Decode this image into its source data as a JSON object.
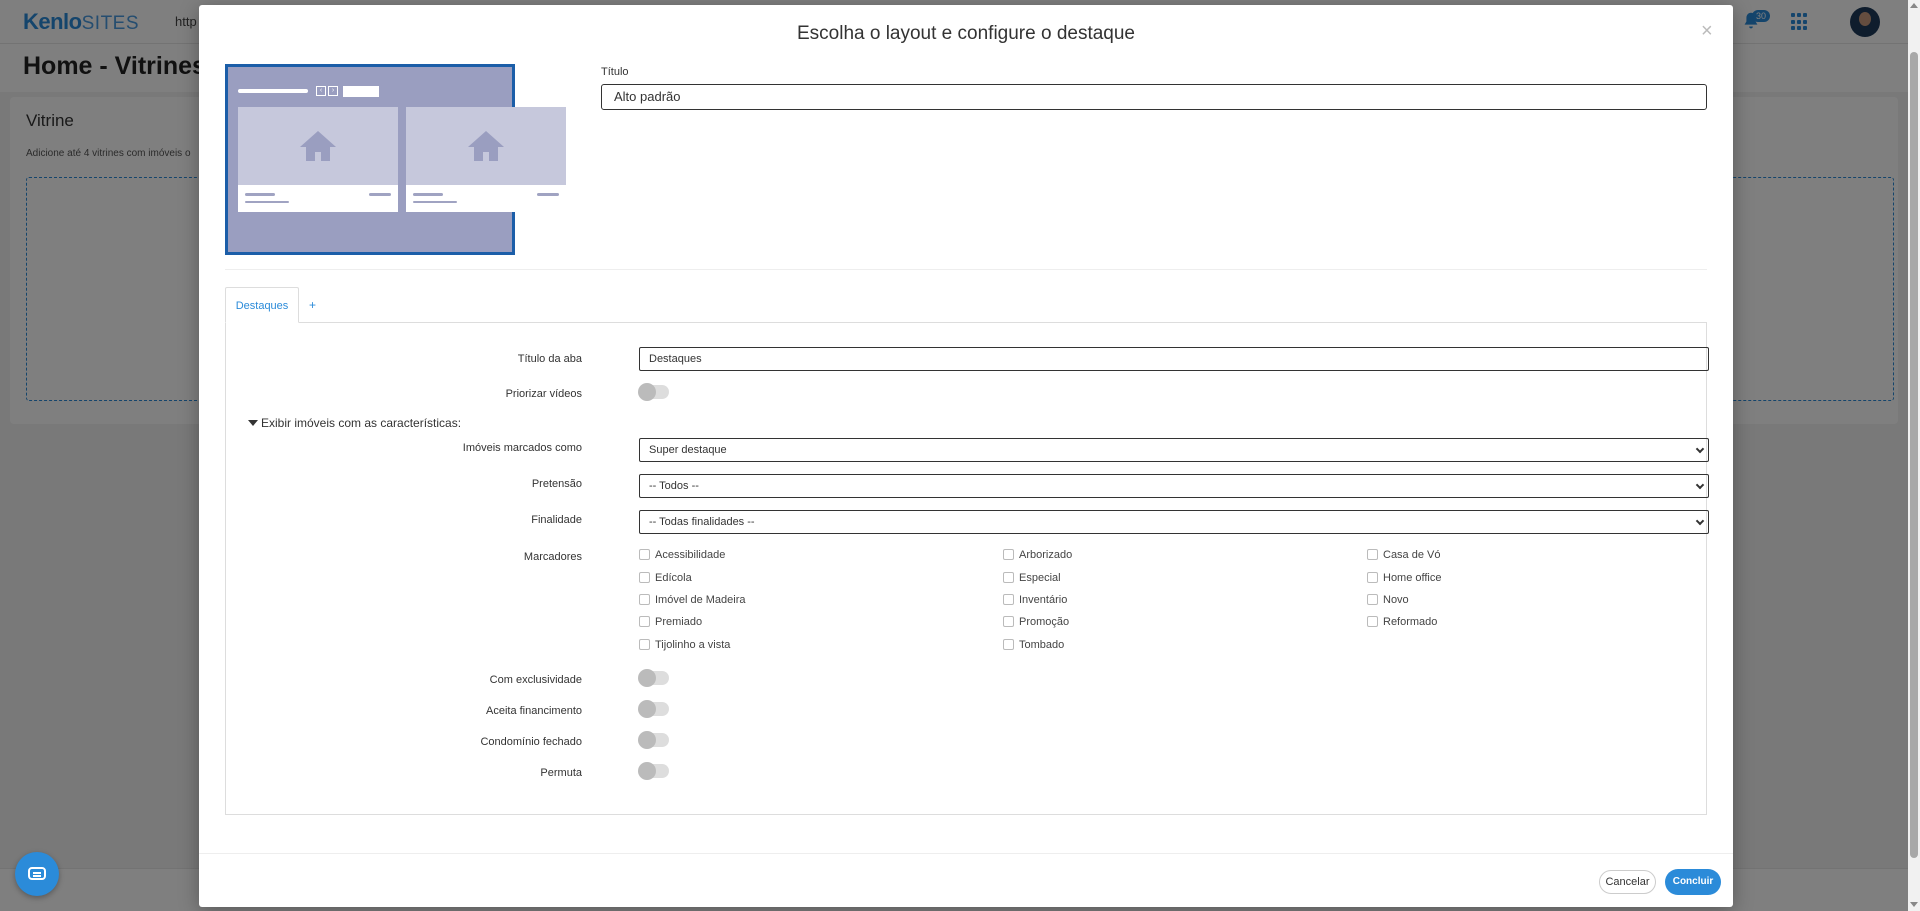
{
  "app": {
    "logo_main": "Kenlo",
    "logo_sub": "SITES",
    "url_stub": "http",
    "notification_count": "30",
    "page_title": "Home - Vitrines"
  },
  "background": {
    "section_title": "Vitrine",
    "section_desc": "Adicione até 4 vitrines com imóveis o"
  },
  "modal": {
    "title": "Escolha o layout e configure o destaque",
    "close_symbol": "×",
    "title_label": "Título",
    "title_value": "Alto padrão",
    "tabs": [
      {
        "label": "Destaques"
      }
    ],
    "add_tab_label": "+",
    "form": {
      "tab_title_label": "Título da aba",
      "tab_title_value": "Destaques",
      "prioritize_videos_label": "Priorizar vídeos",
      "prioritize_videos_on": false,
      "filter_heading": "Exibir imóveis com as características:",
      "marked_as_label": "Imóveis marcados como",
      "marked_as_value": "Super destaque",
      "pretension_label": "Pretensão",
      "pretension_value": "-- Todos --",
      "purpose_label": "Finalidade",
      "purpose_value": "-- Todas finalidades --",
      "markers_label": "Marcadores",
      "markers": [
        {
          "label": "Acessibilidade",
          "checked": false
        },
        {
          "label": "Arborizado",
          "checked": false
        },
        {
          "label": "Casa de Vó",
          "checked": false
        },
        {
          "label": "Edícola",
          "checked": false
        },
        {
          "label": "Especial",
          "checked": false
        },
        {
          "label": "Home office",
          "checked": false
        },
        {
          "label": "Imóvel de Madeira",
          "checked": false
        },
        {
          "label": "Inventário",
          "checked": false
        },
        {
          "label": "Novo",
          "checked": false
        },
        {
          "label": "Premiado",
          "checked": false
        },
        {
          "label": "Promoção",
          "checked": false
        },
        {
          "label": "Reformado",
          "checked": false
        },
        {
          "label": "Tijolinho a vista",
          "checked": false
        },
        {
          "label": "Tombado",
          "checked": false
        }
      ],
      "exclusive_label": "Com exclusividade",
      "exclusive_on": false,
      "financing_label": "Aceita financimento",
      "financing_on": false,
      "gated_label": "Condomínio fechado",
      "gated_on": false,
      "swap_label": "Permuta",
      "swap_on": false
    },
    "cancel_label": "Cancelar",
    "confirm_label": "Concluir"
  },
  "colors": {
    "accent": "#2b8bd9",
    "preview_bg": "#9a9ec0",
    "preview_border": "#1b5ea8"
  }
}
